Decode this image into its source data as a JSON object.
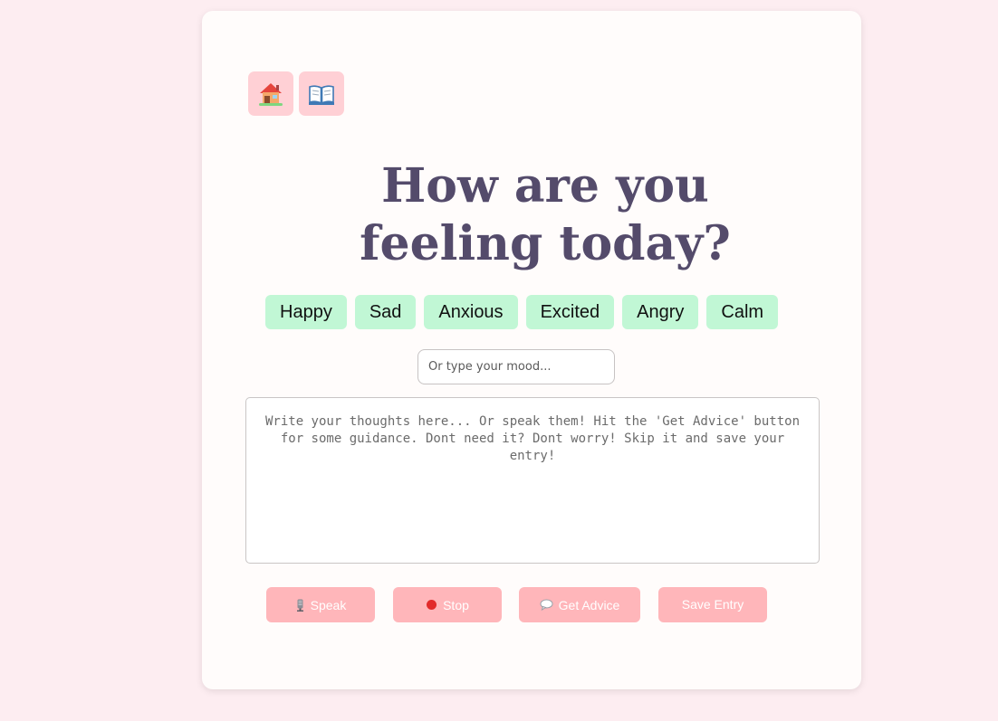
{
  "nav": {
    "home_icon": "house-icon",
    "journal_icon": "open-book-icon"
  },
  "heading": {
    "line1": "How are you",
    "line2": "feeling today?"
  },
  "moods": [
    "Happy",
    "Sad",
    "Anxious",
    "Excited",
    "Angry",
    "Calm"
  ],
  "mood_input": {
    "placeholder": "Or type your mood...",
    "value": ""
  },
  "thoughts": {
    "placeholder": "Write your thoughts here... Or speak them! Hit the 'Get Advice' button for some guidance. Dont need it? Dont worry! Skip it and save your entry!",
    "value": ""
  },
  "actions": {
    "speak": {
      "label": "Speak",
      "icon": "microphone-icon"
    },
    "stop": {
      "label": "Stop",
      "icon": "red-circle-icon"
    },
    "advice": {
      "label": "Get Advice",
      "icon": "speech-bubble-icon"
    },
    "save": {
      "label": "Save Entry"
    }
  },
  "colors": {
    "page_background": "#fdedf1",
    "card_background": "#fffcfb",
    "nav_button": "#ffd0d5",
    "heading": "#544b6b",
    "mood_button": "#c1f7d5",
    "action_button": "#ffb6ba"
  }
}
